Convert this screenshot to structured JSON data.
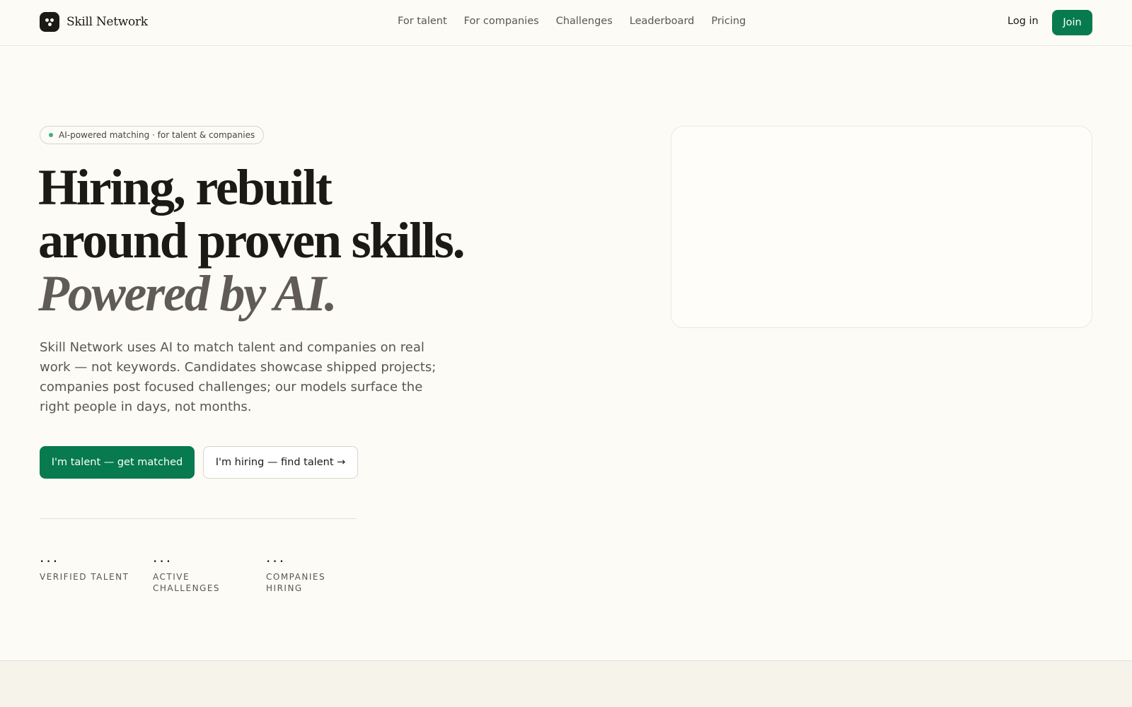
{
  "brand": {
    "name": "Skill Network"
  },
  "nav": {
    "links": [
      "For talent",
      "For companies",
      "Challenges",
      "Leaderboard",
      "Pricing"
    ],
    "login_label": "Log in",
    "join_label": "Join"
  },
  "hero": {
    "pill_text": "AI-powered matching · for talent & companies",
    "headline_line1": "Hiring, rebuilt",
    "headline_line2": "around proven skills.",
    "headline_line3": "Powered by AI.",
    "description": "Skill Network uses AI to match talent and companies on real work — not keywords. Candidates showcase shipped projects; companies post focused challenges; our models surface the right people in days, not months.",
    "primary_cta": "I'm talent — get matched",
    "secondary_cta": "I'm hiring — find talent →"
  },
  "stats": [
    {
      "value": "...",
      "label": "VERIFIED TALENT"
    },
    {
      "value": "...",
      "label": "ACTIVE CHALLENGES"
    },
    {
      "value": "...",
      "label": "COMPANIES HIRING"
    }
  ],
  "colors": {
    "accent": "#077a4f",
    "background": "#fdfbf6",
    "text": "#1c1a16"
  }
}
